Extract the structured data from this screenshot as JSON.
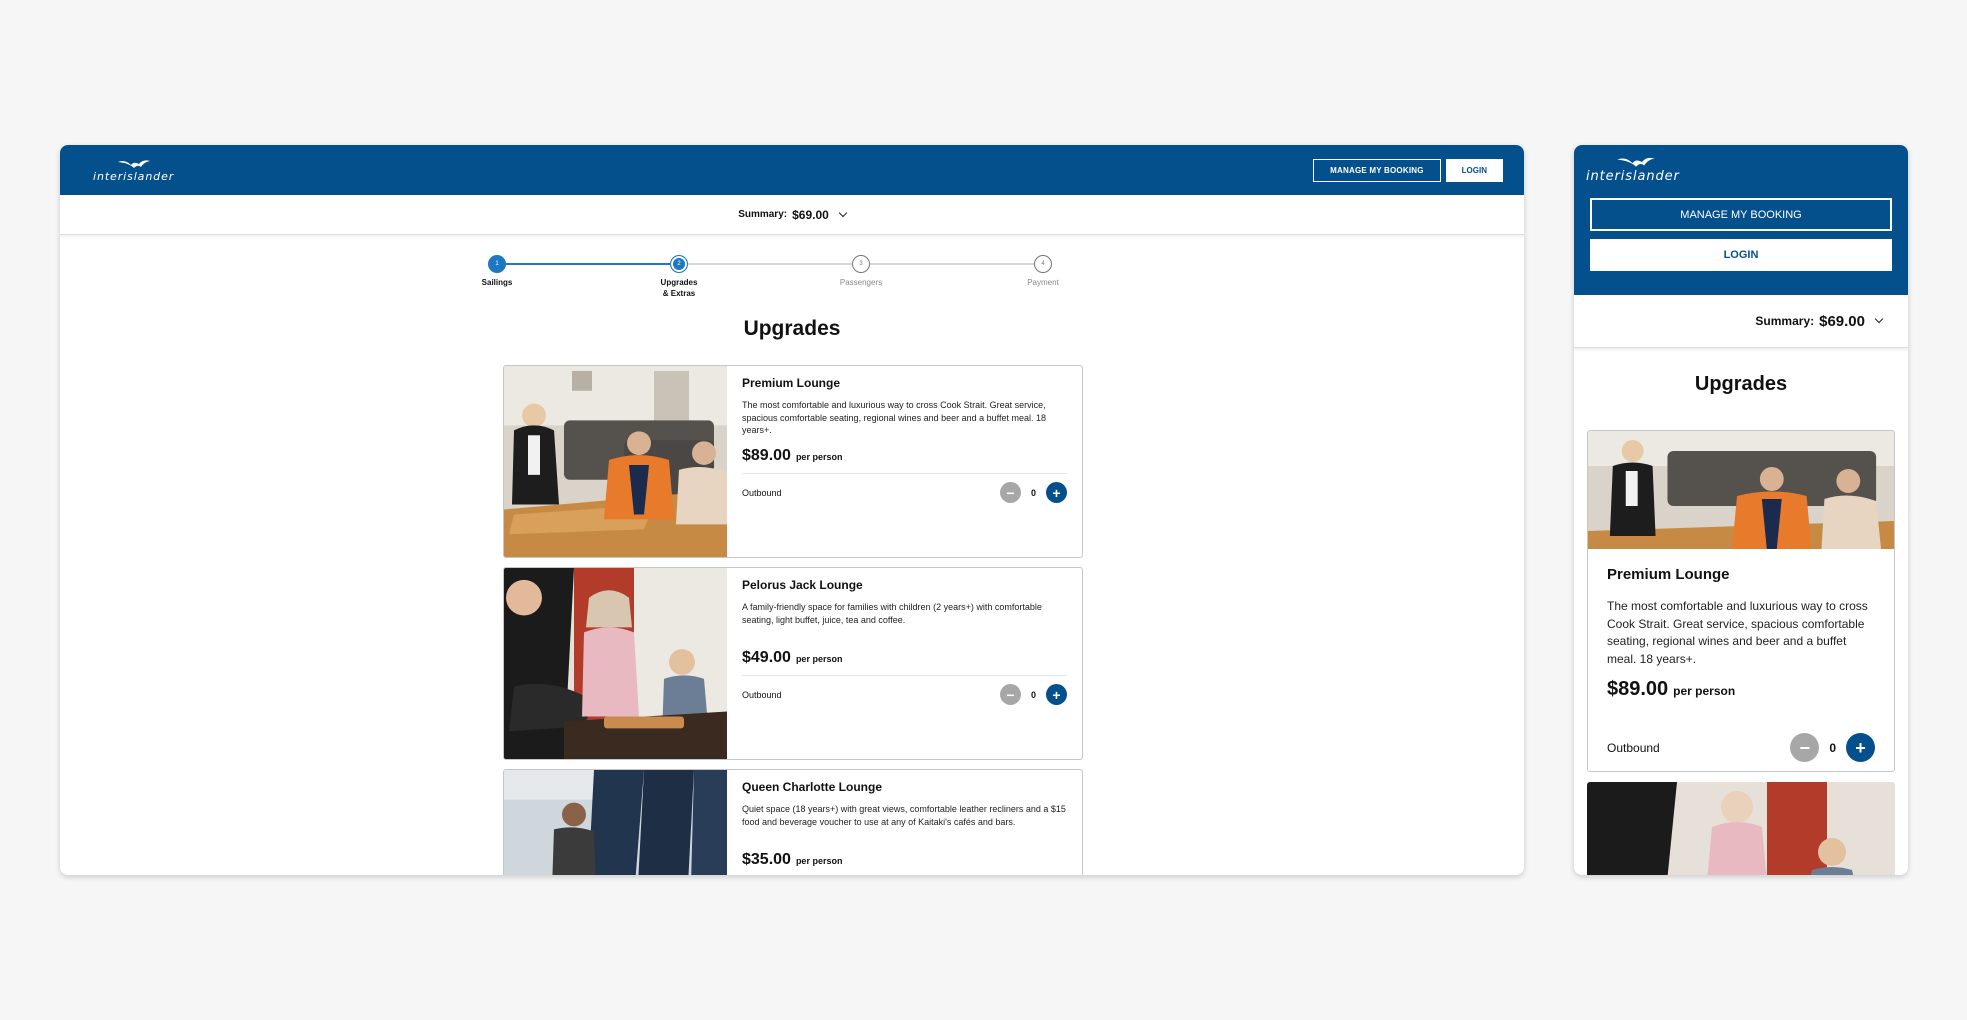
{
  "brand": {
    "name": "interislander",
    "primary_color": "#04508c",
    "accent_color": "#1d78c1"
  },
  "header": {
    "manage_label": "MANAGE MY BOOKING",
    "login_label": "LOGIN"
  },
  "summary": {
    "label": "Summary:",
    "amount": "$69.00"
  },
  "steps": [
    {
      "number": "1",
      "label": "Sailings",
      "state": "done"
    },
    {
      "number": "2",
      "label_line1": "Upgrades",
      "label_line2": "& Extras",
      "state": "active"
    },
    {
      "number": "3",
      "label": "Passengers",
      "state": "todo"
    },
    {
      "number": "4",
      "label": "Payment",
      "state": "todo"
    }
  ],
  "page_title": "Upgrades",
  "upgrades": [
    {
      "title": "Premium Lounge",
      "description": "The most comfortable and luxurious way to cross Cook Strait. Great service, spacious comfortable seating, regional wines and beer and a buffet meal. 18 years+.",
      "price": "$89.00",
      "price_unit": "per person",
      "leg_label": "Outbound",
      "quantity": "0"
    },
    {
      "title": "Pelorus Jack Lounge",
      "description": "A family-friendly space for families with children (2 years+) with comfortable seating, light buffet, juice, tea and coffee.",
      "price": "$49.00",
      "price_unit": "per person",
      "leg_label": "Outbound",
      "quantity": "0"
    },
    {
      "title": "Queen Charlotte Lounge",
      "description": "Quiet space (18 years+) with great views, comfortable leather recliners and a $15 food and beverage voucher to use at any of Kaitaki's cafés and bars.",
      "price": "$35.00",
      "price_unit": "per person"
    }
  ],
  "icons": {
    "minus": "minus-icon",
    "plus": "plus-icon",
    "chevron": "chevron-down-icon",
    "logo": "bird-logo-icon"
  }
}
